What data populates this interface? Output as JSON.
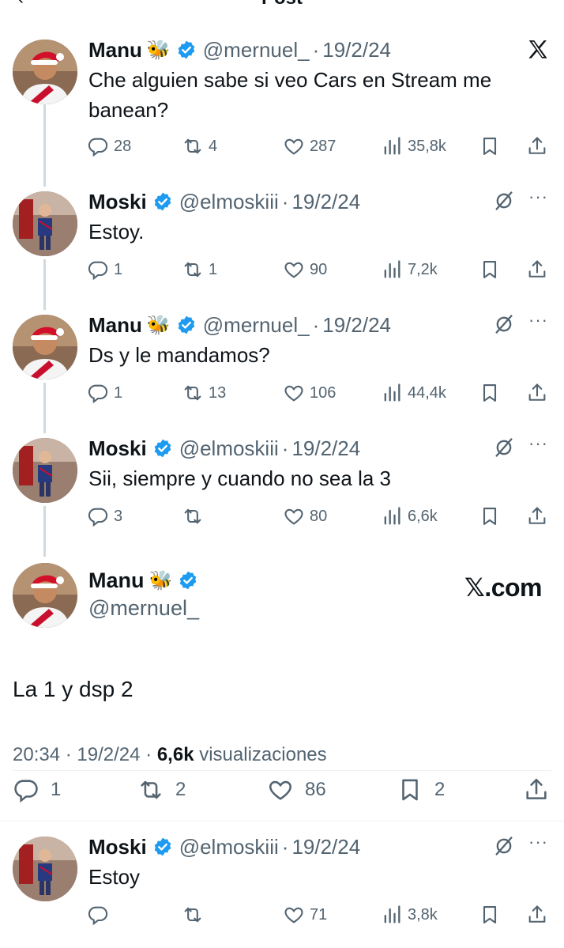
{
  "header": {
    "title": "Post",
    "back_icon": "back-arrow-icon"
  },
  "colors": {
    "verified": "#1d9bf0",
    "text": "#0f1419",
    "muted": "#536471"
  },
  "tweets": [
    {
      "name": "Manu",
      "emoji": "🐝",
      "handle": "@mernuel_",
      "sep": "·",
      "date": "19/2/24",
      "text": "Che alguien sabe si veo Cars en Stream me banean?",
      "corner_icon": "x-logo-icon",
      "replies": "28",
      "reposts": "4",
      "likes": "287",
      "views": "35,8k"
    },
    {
      "name": "Moski",
      "emoji": "",
      "handle": "@elmoskiii",
      "sep": "·",
      "date": "19/2/24",
      "text": "Estoy.",
      "corner_icon": "grok-icon",
      "more": "···",
      "replies": "1",
      "reposts": "1",
      "likes": "90",
      "views": "7,2k"
    },
    {
      "name": "Manu",
      "emoji": "🐝",
      "handle": "@mernuel_",
      "sep": "·",
      "date": "19/2/24",
      "text": "Ds y le mandamos?",
      "corner_icon": "grok-icon",
      "more": "···",
      "replies": "1",
      "reposts": "13",
      "likes": "106",
      "views": "44,4k"
    },
    {
      "name": "Moski",
      "emoji": "",
      "handle": "@elmoskiii",
      "sep": "·",
      "date": "19/2/24",
      "text": "Sii, siempre y cuando no sea la 3",
      "corner_icon": "grok-icon",
      "more": "···",
      "replies": "3",
      "reposts": "",
      "likes": "80",
      "views": "6,6k"
    }
  ],
  "main": {
    "name": "Manu",
    "emoji": "🐝",
    "handle": "@mernuel_",
    "brand": "𝕏.com",
    "text": "La 1 y dsp 2",
    "time": "20:34",
    "sep": "·",
    "date": "19/2/24",
    "views_count": "6,6k",
    "views_label": "visualizaciones",
    "replies": "1",
    "reposts": "2",
    "likes": "86",
    "bookmarks": "2"
  },
  "reply": {
    "name": "Moski",
    "handle": "@elmoskiii",
    "sep": "·",
    "date": "19/2/24",
    "text": "Estoy",
    "more": "···",
    "replies": "",
    "reposts": "",
    "likes": "71",
    "views": "3,8k"
  }
}
